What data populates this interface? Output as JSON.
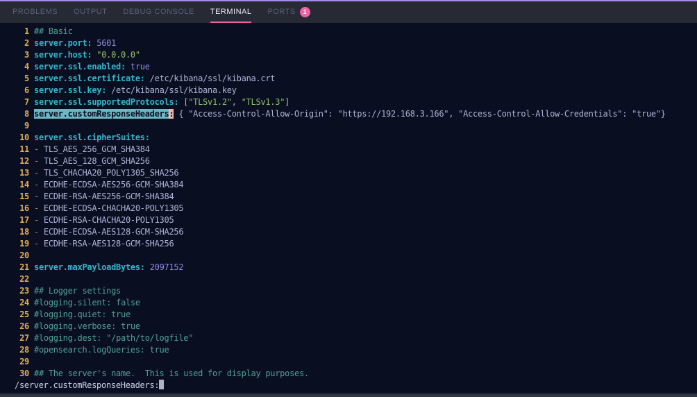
{
  "panel_tabs": {
    "items": [
      {
        "label": "PROBLEMS",
        "active": false
      },
      {
        "label": "OUTPUT",
        "active": false
      },
      {
        "label": "DEBUG CONSOLE",
        "active": false
      },
      {
        "label": "TERMINAL",
        "active": true
      },
      {
        "label": "PORTS",
        "active": false
      }
    ],
    "ports_badge": "1"
  },
  "colors": {
    "panel_accent_border": "#a48be6",
    "tabbar_background": "#272935",
    "active_tab_underline": "#ee61a5",
    "ports_badge_background": "#ee61a5",
    "terminal_background": "#0a0e21",
    "line_number": "#e0ae5a",
    "comment": "#4fa192",
    "yaml_key": "#35b5c9",
    "string": "#93c068",
    "number_bool": "#8f8ce0",
    "plain_text": "#aeb4d8",
    "list_dash": "#d08c52",
    "search_match_background": "#6bb7c2",
    "search_cursor_cell_background": "#edb7ac"
  },
  "terminal": {
    "lines": [
      {
        "num": "1",
        "segments": [
          {
            "t": "## Basic",
            "c": "comment"
          }
        ]
      },
      {
        "num": "2",
        "segments": [
          {
            "t": "server.port:",
            "c": "key"
          },
          {
            "t": " ",
            "c": "plain"
          },
          {
            "t": "5601",
            "c": "num"
          }
        ]
      },
      {
        "num": "3",
        "segments": [
          {
            "t": "server.host:",
            "c": "key"
          },
          {
            "t": " ",
            "c": "plain"
          },
          {
            "t": "\"0.0.0.0\"",
            "c": "str"
          }
        ]
      },
      {
        "num": "4",
        "segments": [
          {
            "t": "server.ssl.enabled:",
            "c": "key"
          },
          {
            "t": " ",
            "c": "plain"
          },
          {
            "t": "true",
            "c": "num"
          }
        ]
      },
      {
        "num": "5",
        "segments": [
          {
            "t": "server.ssl.certificate:",
            "c": "key"
          },
          {
            "t": " /etc/kibana/ssl/kibana.crt",
            "c": "plain"
          }
        ]
      },
      {
        "num": "6",
        "segments": [
          {
            "t": "server.ssl.key:",
            "c": "key"
          },
          {
            "t": " /etc/kibana/ssl/kibana.key",
            "c": "plain"
          }
        ]
      },
      {
        "num": "7",
        "segments": [
          {
            "t": "server.ssl.supportedProtocols:",
            "c": "key"
          },
          {
            "t": " [",
            "c": "plain"
          },
          {
            "t": "\"TLSv1.2\"",
            "c": "str"
          },
          {
            "t": ", ",
            "c": "plain"
          },
          {
            "t": "\"TLSv1.3\"",
            "c": "str"
          },
          {
            "t": "]",
            "c": "plain"
          }
        ]
      },
      {
        "num": "8",
        "segments": [
          {
            "t": "server.customResponseHeaders",
            "c": "hlkey"
          },
          {
            "t": ":",
            "c": "hlcolon"
          },
          {
            "t": " { \"Access-Control-Allow-Origin\": \"https://192.168.3.166\", \"Access-Control-Allow-Credentials\": \"true\"}",
            "c": "plain"
          }
        ]
      },
      {
        "num": "9",
        "segments": []
      },
      {
        "num": "10",
        "segments": [
          {
            "t": "server.ssl.cipherSuites:",
            "c": "key"
          }
        ]
      },
      {
        "num": "11",
        "segments": [
          {
            "t": "- ",
            "c": "dash"
          },
          {
            "t": "TLS_AES_256_GCM_SHA384",
            "c": "plain"
          }
        ]
      },
      {
        "num": "12",
        "segments": [
          {
            "t": "- ",
            "c": "dash"
          },
          {
            "t": "TLS_AES_128_GCM_SHA256",
            "c": "plain"
          }
        ]
      },
      {
        "num": "13",
        "segments": [
          {
            "t": "- ",
            "c": "dash"
          },
          {
            "t": "TLS_CHACHA20_POLY1305_SHA256",
            "c": "plain"
          }
        ]
      },
      {
        "num": "14",
        "segments": [
          {
            "t": "- ",
            "c": "dash"
          },
          {
            "t": "ECDHE-ECDSA-AES256-GCM-SHA384",
            "c": "plain"
          }
        ]
      },
      {
        "num": "15",
        "segments": [
          {
            "t": "- ",
            "c": "dash"
          },
          {
            "t": "ECDHE-RSA-AES256-GCM-SHA384",
            "c": "plain"
          }
        ]
      },
      {
        "num": "16",
        "segments": [
          {
            "t": "- ",
            "c": "dash"
          },
          {
            "t": "ECDHE-ECDSA-CHACHA20-POLY1305",
            "c": "plain"
          }
        ]
      },
      {
        "num": "17",
        "segments": [
          {
            "t": "- ",
            "c": "dash"
          },
          {
            "t": "ECDHE-RSA-CHACHA20-POLY1305",
            "c": "plain"
          }
        ]
      },
      {
        "num": "18",
        "segments": [
          {
            "t": "- ",
            "c": "dash"
          },
          {
            "t": "ECDHE-ECDSA-AES128-GCM-SHA256",
            "c": "plain"
          }
        ]
      },
      {
        "num": "19",
        "segments": [
          {
            "t": "- ",
            "c": "dash"
          },
          {
            "t": "ECDHE-RSA-AES128-GCM-SHA256",
            "c": "plain"
          }
        ]
      },
      {
        "num": "20",
        "segments": []
      },
      {
        "num": "21",
        "segments": [
          {
            "t": "server.maxPayloadBytes:",
            "c": "key"
          },
          {
            "t": " ",
            "c": "plain"
          },
          {
            "t": "2097152",
            "c": "num"
          }
        ]
      },
      {
        "num": "22",
        "segments": []
      },
      {
        "num": "23",
        "segments": [
          {
            "t": "## Logger settings",
            "c": "comment"
          }
        ]
      },
      {
        "num": "24",
        "segments": [
          {
            "t": "#logging.silent: false",
            "c": "comment"
          }
        ]
      },
      {
        "num": "25",
        "segments": [
          {
            "t": "#logging.quiet: true",
            "c": "comment"
          }
        ]
      },
      {
        "num": "26",
        "segments": [
          {
            "t": "#logging.verbose: true",
            "c": "comment"
          }
        ]
      },
      {
        "num": "27",
        "segments": [
          {
            "t": "#logging.dest: \"/path/to/logfile\"",
            "c": "comment"
          }
        ]
      },
      {
        "num": "28",
        "segments": [
          {
            "t": "#opensearch.logQueries: true",
            "c": "comment"
          }
        ]
      },
      {
        "num": "29",
        "segments": []
      },
      {
        "num": "30",
        "segments": [
          {
            "t": "## The server's name.  This is used for display purposes.",
            "c": "comment"
          }
        ]
      }
    ],
    "search_prompt": "/server.customResponseHeaders:"
  }
}
